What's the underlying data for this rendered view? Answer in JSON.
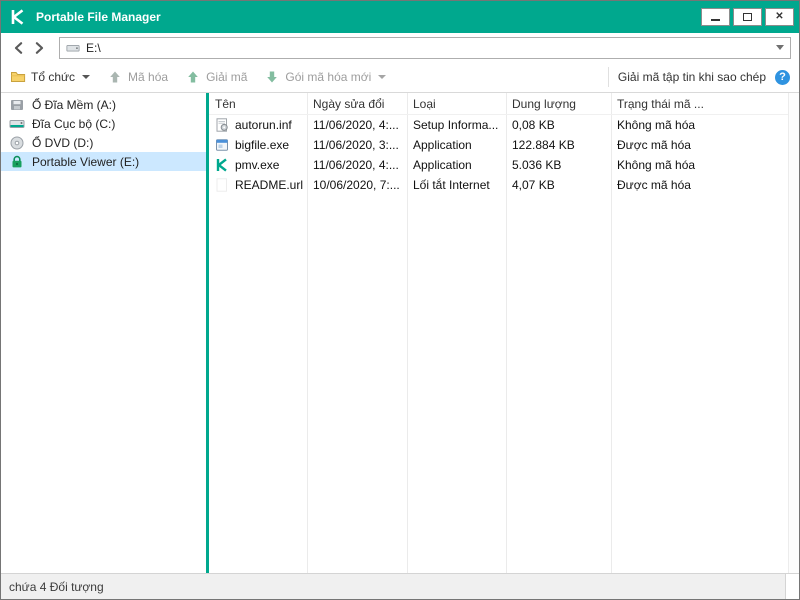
{
  "window": {
    "title": "Portable File Manager",
    "controls": {
      "close_glyph": "✕"
    }
  },
  "address_bar": {
    "value": "E:\\"
  },
  "toolbar": {
    "items": [
      {
        "label": "Tổ chức",
        "enabled": true,
        "has_caret": true,
        "icon": "folder-icon"
      },
      {
        "label": "Mã hóa",
        "enabled": false,
        "has_caret": false,
        "icon": "encrypt-arrow-icon"
      },
      {
        "label": "Giải mã",
        "enabled": false,
        "has_caret": false,
        "icon": "decrypt-arrow-icon"
      },
      {
        "label": "Gói mã hóa mới",
        "enabled": false,
        "has_caret": true,
        "icon": "new-package-arrow-icon"
      }
    ],
    "right_label": "Giải mã tập tin khi sao chép",
    "help_glyph": "?"
  },
  "sidebar": {
    "items": [
      {
        "label": "Ổ Đĩa Mềm (A:)",
        "icon": "floppy-icon",
        "selected": false
      },
      {
        "label": "Đĩa Cục bộ (C:)",
        "icon": "hdd-icon",
        "selected": false
      },
      {
        "label": "Ổ DVD (D:)",
        "icon": "dvd-icon",
        "selected": false
      },
      {
        "label": "Portable Viewer (E:)",
        "icon": "lock-icon",
        "selected": true
      }
    ]
  },
  "file_list": {
    "columns": [
      "Tên",
      "Ngày sửa đổi",
      "Loại",
      "Dung lượng",
      "Trạng thái mã ..."
    ],
    "rows": [
      {
        "name": "autorun.inf",
        "modified": "11/06/2020, 4:...",
        "type": "Setup Informa...",
        "size": "0,08 KB",
        "status": "Không mã hóa",
        "icon": "setup-info-icon"
      },
      {
        "name": "bigfile.exe",
        "modified": "11/06/2020, 3:...",
        "type": "Application",
        "size": "122.884 KB",
        "status": "Được mã hóa",
        "icon": "application-icon"
      },
      {
        "name": "pmv.exe",
        "modified": "11/06/2020, 4:...",
        "type": "Application",
        "size": "5.036 KB",
        "status": "Không mã hóa",
        "icon": "kaspersky-icon"
      },
      {
        "name": "README.url",
        "modified": "10/06/2020, 7:...",
        "type": "Lối tắt Internet",
        "size": "4,07 KB",
        "status": "Được mã hóa",
        "icon": "url-icon"
      }
    ]
  },
  "status_bar": {
    "text": "chứa 4 Đối tượng"
  },
  "colors": {
    "accent": "#00A88E",
    "selection": "#cce8ff"
  }
}
